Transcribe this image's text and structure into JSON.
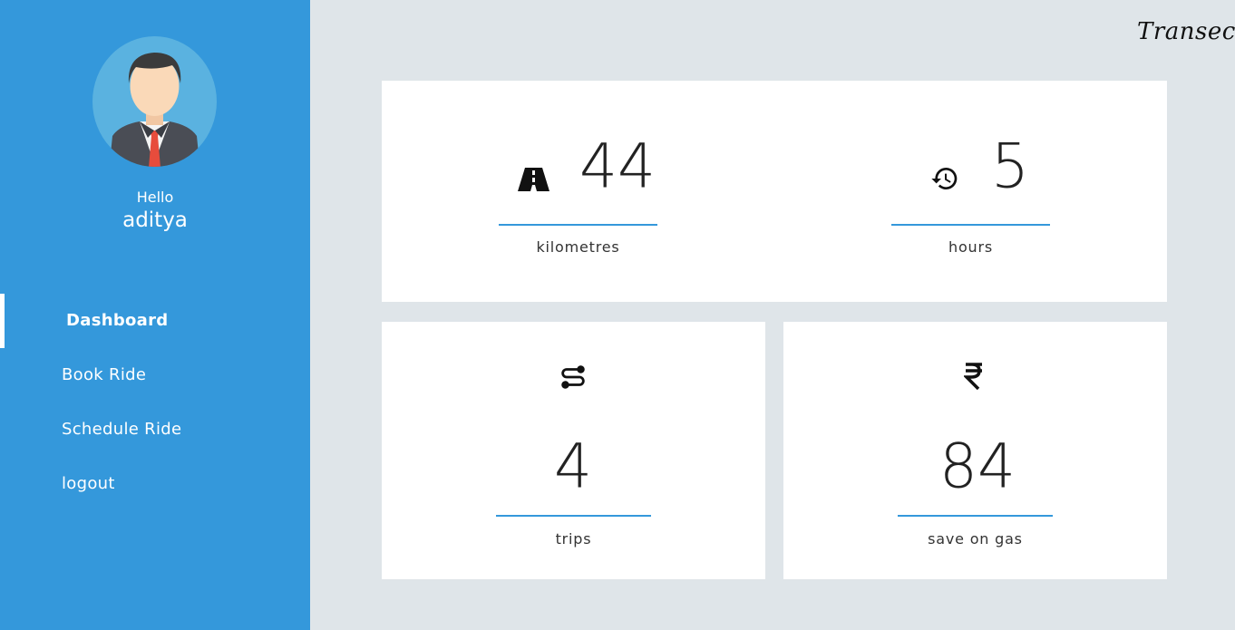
{
  "sidebar": {
    "greeting": "Hello",
    "username": "aditya",
    "nav": [
      {
        "label": "Dashboard",
        "active": true
      },
      {
        "label": "Book Ride",
        "active": false
      },
      {
        "label": "Schedule Ride",
        "active": false
      },
      {
        "label": "logout",
        "active": false
      }
    ]
  },
  "header": {
    "brand": "Transeco"
  },
  "stats": {
    "kilometres": {
      "value": "44",
      "label": "kilometres",
      "icon": "road-icon"
    },
    "hours": {
      "value": "5",
      "label": "hours",
      "icon": "history-icon"
    },
    "trips": {
      "value": "4",
      "label": "trips",
      "icon": "route-icon"
    },
    "gas": {
      "value": "84",
      "label": "save on gas",
      "icon": "rupee-icon"
    }
  },
  "colors": {
    "accent": "#3498db",
    "background": "#dfe5e9",
    "card": "#ffffff"
  }
}
